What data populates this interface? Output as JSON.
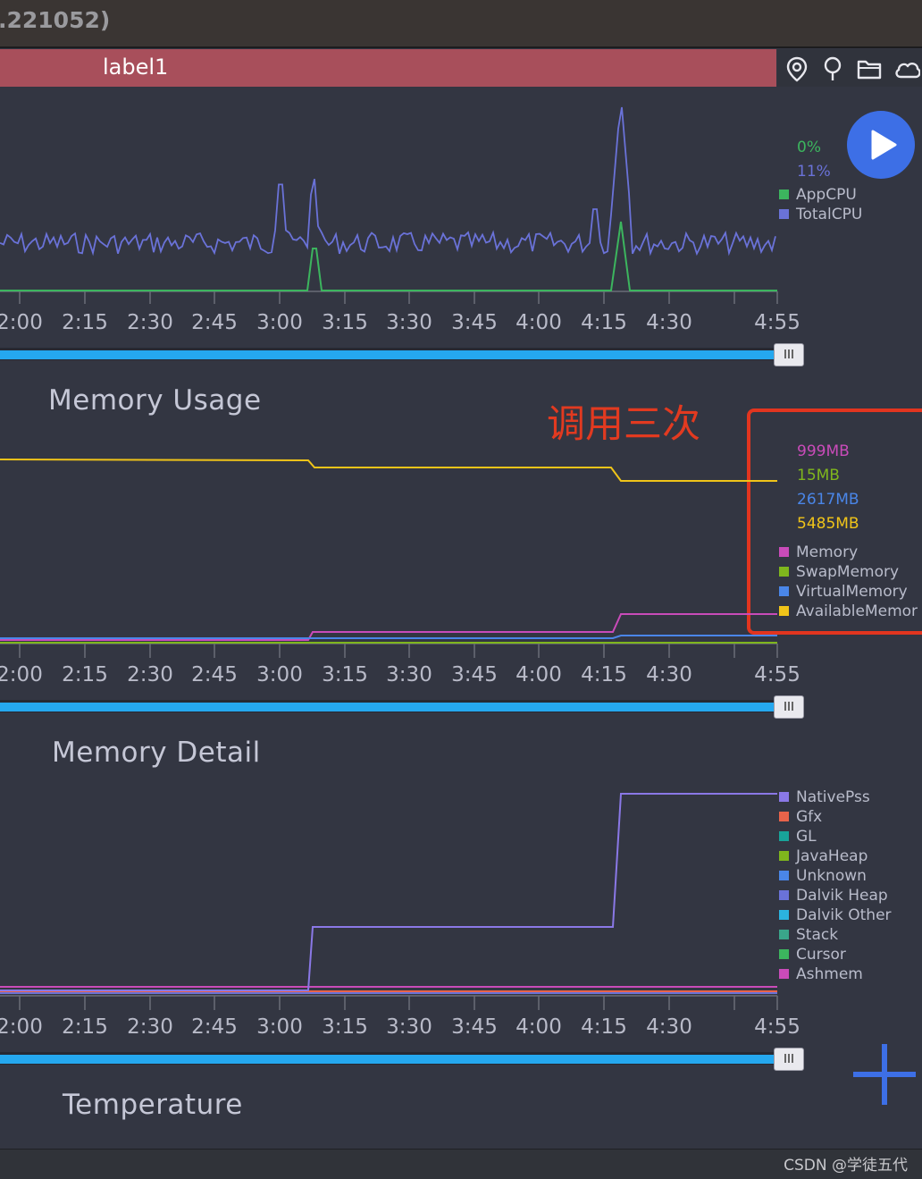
{
  "window": {
    "title_fragment": ".221052)"
  },
  "label_bar": {
    "text": "label1"
  },
  "toolbar": {
    "icons": [
      "map-pin-icon",
      "location-marker-icon",
      "folder-icon",
      "cloud-icon"
    ]
  },
  "colors": {
    "AppCPU": "#3cb55e",
    "TotalCPU": "#6a72d8",
    "Memory": "#c94bb9",
    "SwapMemory": "#7fb61d",
    "VirtualMemory": "#4a86e8",
    "AvailableMemory": "#f0c419",
    "NativePss": "#8a78e6",
    "Gfx": "#e8634a",
    "GL": "#18a49a",
    "JavaHeap": "#7fb61d",
    "Unknown": "#4a86e8",
    "DalvikHeap": "#6a72d8",
    "DalvikOther": "#2bb3df",
    "Stack": "#3aa58a",
    "Cursor": "#3cb55e",
    "Ashmem": "#c94bb9",
    "accent": "#3d6fe6",
    "annotation": "#e2351f"
  },
  "time_axis": [
    "2:00",
    "2:15",
    "2:30",
    "2:45",
    "3:00",
    "3:15",
    "3:30",
    "3:45",
    "4:00",
    "4:15",
    "4:30",
    "4:55"
  ],
  "cpu": {
    "legend_values": [
      {
        "text": "0%",
        "color": "#3cb55e"
      },
      {
        "text": "11%",
        "color": "#6a72d8"
      }
    ],
    "legend": [
      "AppCPU",
      "TotalCPU"
    ]
  },
  "memory_usage": {
    "title": "Memory Usage",
    "annotation": "调用三次",
    "legend_values": [
      {
        "text": "999MB",
        "color": "#c94bb9"
      },
      {
        "text": "15MB",
        "color": "#7fb61d"
      },
      {
        "text": "2617MB",
        "color": "#4a86e8"
      },
      {
        "text": "5485MB",
        "color": "#f0c419"
      }
    ],
    "legend": [
      "Memory",
      "SwapMemory",
      "VirtualMemory",
      "AvailableMemor"
    ]
  },
  "memory_detail": {
    "title": "Memory Detail",
    "legend": [
      "NativePss",
      "Gfx",
      "GL",
      "JavaHeap",
      "Unknown",
      "Dalvik Heap",
      "Dalvik Other",
      "Stack",
      "Cursor",
      "Ashmem"
    ]
  },
  "temperature": {
    "title": "Temperature"
  },
  "footer": {
    "watermark": "CSDN @学徒五代"
  }
}
